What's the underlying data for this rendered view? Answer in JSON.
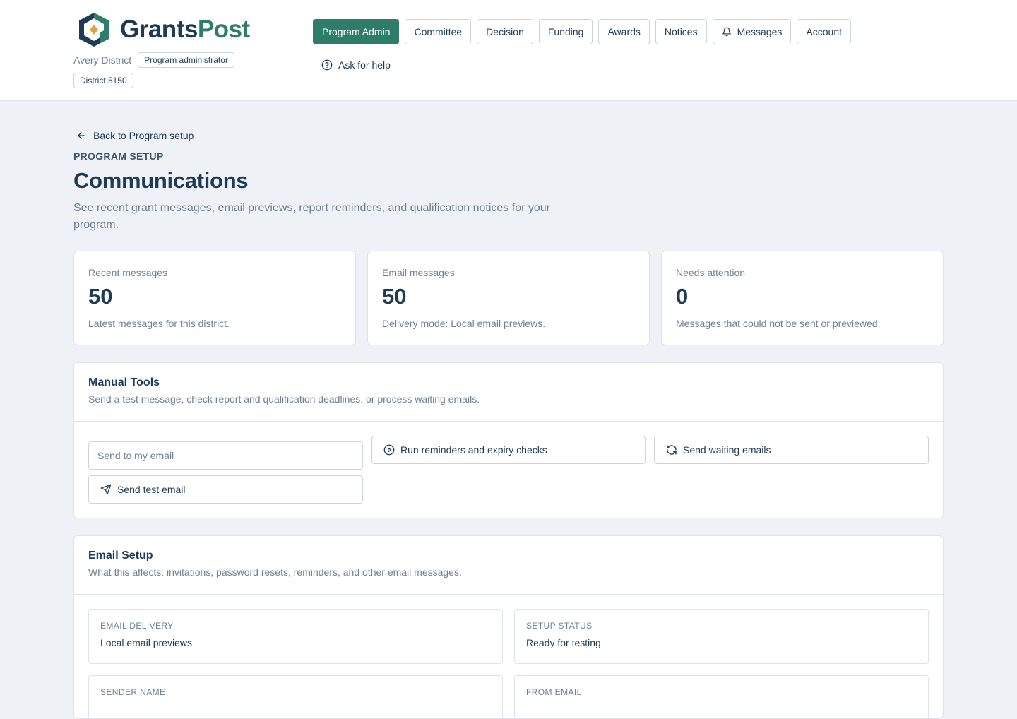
{
  "brand": {
    "name_part1": "Grants",
    "name_part2": "Post",
    "accent": "#2e7d6a",
    "navy": "#1e3a55"
  },
  "org": {
    "name": "Avery District",
    "role": "Program administrator",
    "district": "District 5150"
  },
  "nav": {
    "items": [
      {
        "label": "Program Admin",
        "active": true
      },
      {
        "label": "Committee"
      },
      {
        "label": "Decision"
      },
      {
        "label": "Funding"
      },
      {
        "label": "Awards"
      },
      {
        "label": "Notices"
      },
      {
        "label": "Messages",
        "icon": "bell-icon"
      },
      {
        "label": "Account"
      }
    ],
    "help": "Ask for help"
  },
  "page": {
    "back": "Back to Program setup",
    "eyebrow": "PROGRAM SETUP",
    "title": "Communications",
    "description": "See recent grant messages, email previews, report reminders, and qualification notices for your program."
  },
  "stats": [
    {
      "label": "Recent messages",
      "value": "50",
      "sub": "Latest messages for this district."
    },
    {
      "label": "Email messages",
      "value": "50",
      "sub": "Delivery mode: Local email previews."
    },
    {
      "label": "Needs attention",
      "value": "0",
      "sub": "Messages that could not be sent or previewed."
    }
  ],
  "manual_tools": {
    "title": "Manual Tools",
    "subtitle": "Send a test message, check report and qualification deadlines, or process waiting emails.",
    "email_placeholder": "Send to my email",
    "send_test": "Send test email",
    "run_checks": "Run reminders and expiry checks",
    "send_waiting": "Send waiting emails"
  },
  "email_setup": {
    "title": "Email Setup",
    "subtitle": "What this affects: invitations, password resets, reminders, and other email messages.",
    "fields": [
      {
        "key": "EMAIL DELIVERY",
        "value": "Local email previews"
      },
      {
        "key": "SETUP STATUS",
        "value": "Ready for testing"
      },
      {
        "key": "SENDER NAME",
        "value": ""
      },
      {
        "key": "FROM EMAIL",
        "value": ""
      }
    ]
  }
}
